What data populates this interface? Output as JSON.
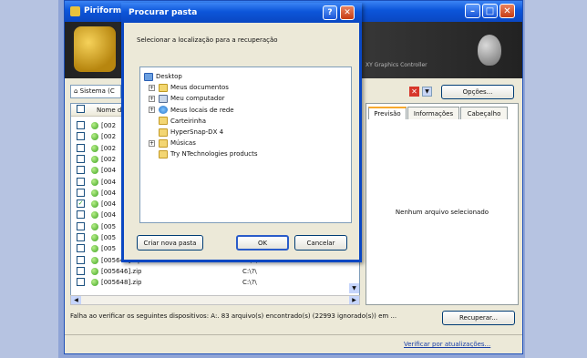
{
  "main_window": {
    "title": "Piriform",
    "drive_combo": "Sistema (C",
    "column_header": "Nome d",
    "options_button": "Opções...",
    "header_text": "XY Graphics Controller",
    "files": [
      {
        "name": "[002",
        "checked": false
      },
      {
        "name": "[002",
        "checked": false
      },
      {
        "name": "[002",
        "checked": false
      },
      {
        "name": "[002",
        "checked": false
      },
      {
        "name": "[004",
        "checked": false
      },
      {
        "name": "[004",
        "checked": false
      },
      {
        "name": "[004",
        "checked": false
      },
      {
        "name": "[004",
        "checked": true
      },
      {
        "name": "[004",
        "checked": false
      },
      {
        "name": "[005",
        "checked": false
      },
      {
        "name": "[005",
        "checked": false
      },
      {
        "name": "[005",
        "checked": false
      },
      {
        "name": "[005645].zip",
        "path": "C:\\?\\",
        "checked": false
      },
      {
        "name": "[005646].zip",
        "path": "C:\\?\\",
        "checked": false
      },
      {
        "name": "[005648].zip",
        "path": "C:\\?\\",
        "checked": false
      }
    ],
    "tabs": [
      "Previsão",
      "Informações",
      "Cabeçalho"
    ],
    "no_selection_text": "Nenhum arquivo selecionado",
    "status_text": "Falha ao verificar os seguintes dispositivos: A:. 83 arquivo(s) encontrado(s) (22993 ignorado(s)) em ...",
    "recover_button": "Recuperar...",
    "update_link": "Verificar por atualizações..."
  },
  "dialog": {
    "title": "Procurar pasta",
    "help_glyph": "?",
    "close_glyph": "✕",
    "prompt": "Selecionar a localização para a recuperação",
    "tree": [
      {
        "label": "Desktop",
        "level": 0,
        "expandable": false,
        "icon": "desktop-icon"
      },
      {
        "label": "Meus documentos",
        "level": 1,
        "expandable": true,
        "icon": "documents-icon"
      },
      {
        "label": "Meu computador",
        "level": 1,
        "expandable": true,
        "icon": "computer-icon"
      },
      {
        "label": "Meus locais de rede",
        "level": 1,
        "expandable": true,
        "icon": "network-icon"
      },
      {
        "label": "Carteirinha",
        "level": 1,
        "expandable": false,
        "icon": "folder-icon"
      },
      {
        "label": "HyperSnap-DX 4",
        "level": 1,
        "expandable": false,
        "icon": "folder-icon"
      },
      {
        "label": "Músicas",
        "level": 1,
        "expandable": true,
        "icon": "folder-icon"
      },
      {
        "label": "Try NTechnologies products",
        "level": 1,
        "expandable": false,
        "icon": "folder-icon"
      }
    ],
    "new_folder_button": "Criar nova pasta",
    "ok_button": "OK",
    "cancel_button": "Cancelar"
  }
}
